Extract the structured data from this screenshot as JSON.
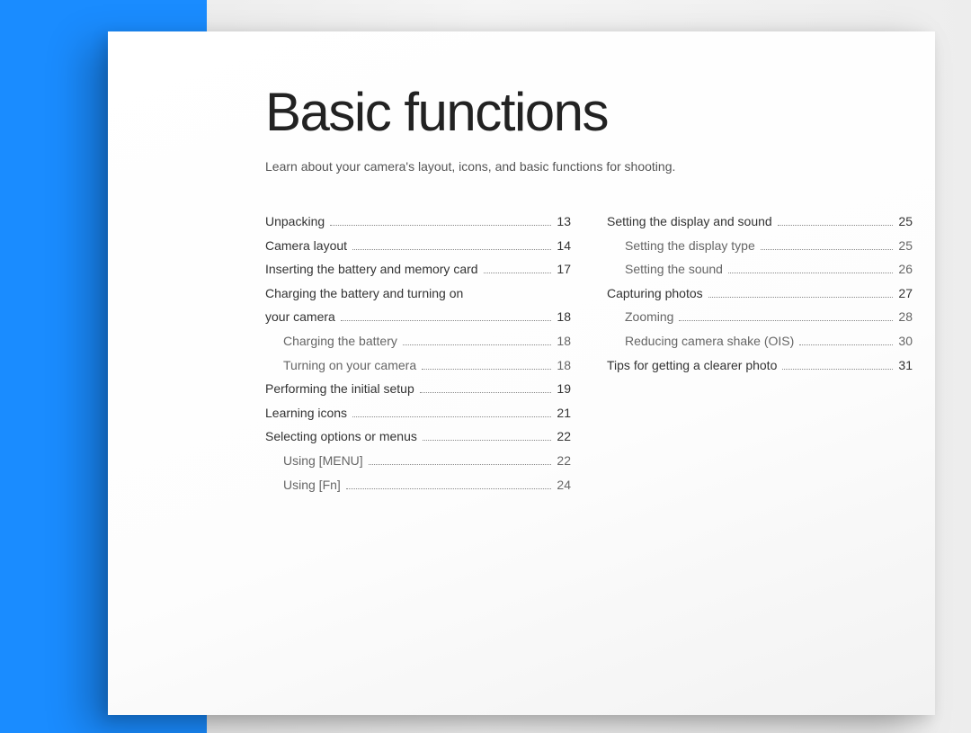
{
  "title": "Basic functions",
  "subtitle": "Learn about your camera's layout, icons, and basic functions for shooting.",
  "col1": [
    {
      "label": "Unpacking",
      "page": "13",
      "sub": false
    },
    {
      "label": "Camera layout",
      "page": "14",
      "sub": false
    },
    {
      "label": "Inserting the battery and memory card",
      "page": "17",
      "sub": false
    },
    {
      "label": "Charging the battery and turning on",
      "page": "",
      "sub": false,
      "nodots": true
    },
    {
      "label": "your camera",
      "page": "18",
      "sub": false
    },
    {
      "label": "Charging the battery",
      "page": "18",
      "sub": true
    },
    {
      "label": "Turning on your camera",
      "page": "18",
      "sub": true
    },
    {
      "label": "Performing the initial setup",
      "page": "19",
      "sub": false
    },
    {
      "label": "Learning icons",
      "page": "21",
      "sub": false
    },
    {
      "label": "Selecting options or menus",
      "page": "22",
      "sub": false
    },
    {
      "label": "Using [MENU]",
      "page": "22",
      "sub": true
    },
    {
      "label": "Using [Fn]",
      "page": "24",
      "sub": true
    }
  ],
  "col2": [
    {
      "label": "Setting the display and sound",
      "page": "25",
      "sub": false
    },
    {
      "label": "Setting the display type",
      "page": "25",
      "sub": true
    },
    {
      "label": "Setting the sound",
      "page": "26",
      "sub": true
    },
    {
      "label": "Capturing photos",
      "page": "27",
      "sub": false
    },
    {
      "label": "Zooming",
      "page": "28",
      "sub": true
    },
    {
      "label": "Reducing camera shake (OIS)",
      "page": "30",
      "sub": true
    },
    {
      "label": "Tips for getting a clearer photo",
      "page": "31",
      "sub": false
    }
  ]
}
